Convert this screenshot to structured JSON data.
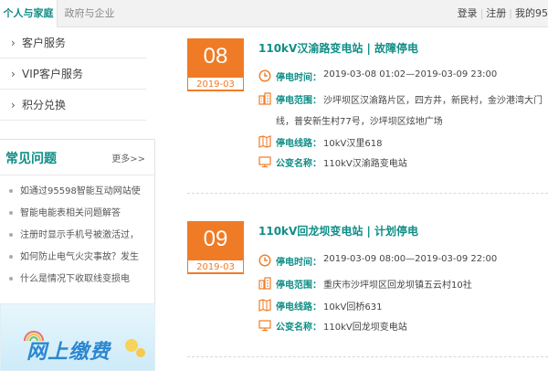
{
  "topbar": {
    "tab_personal": "个人与家庭",
    "tab_gov": "政府与企业",
    "login": "登录",
    "register": "注册",
    "my": "我的95"
  },
  "sidebar": {
    "items": [
      {
        "label": "客户服务"
      },
      {
        "label": "VIP客户服务"
      },
      {
        "label": "积分兑换"
      }
    ],
    "faq": {
      "title": "常见问题",
      "more": "更多>>",
      "items": [
        "如通过95598智能互动网站使",
        "智能电能表相关问题解答",
        "注册时显示手机号被激活过，",
        "如何防止电气火灾事故？发生",
        "什么是情况下收取线变损电"
      ]
    },
    "banner_text": "网上缴费"
  },
  "outages": [
    {
      "day": "08",
      "month": "2019-03",
      "title": "110kV汉渝路变电站 | 故障停电",
      "time_label": "停电时间：",
      "time": "2019-03-08 01:02—2019-03-09 23:00",
      "range_label": "停电范围：",
      "range_line1": "沙坪坝区汉渝路片区，四方井，新民村，金沙港湾大门",
      "range_line2": "线，普安新生村77号，沙坪坝区炫地广场",
      "line_label": "停电线路：",
      "line": "10kV汉里618",
      "station_label": "公变名称：",
      "station": "110kV汉渝路变电站"
    },
    {
      "day": "09",
      "month": "2019-03",
      "title": "110kV回龙坝变电站 | 计划停电",
      "time_label": "停电时间：",
      "time": "2019-03-09 08:00—2019-03-09 22:00",
      "range_label": "停电范围：",
      "range_line1": "重庆市沙坪坝区回龙坝镇五云村10社",
      "line_label": "停电线路：",
      "line": "10kV回桥631",
      "station_label": "公变名称：",
      "station": "110kV回龙坝变电站"
    }
  ],
  "colors": {
    "accent": "#0f8e86",
    "date_orange": "#f07b26"
  }
}
